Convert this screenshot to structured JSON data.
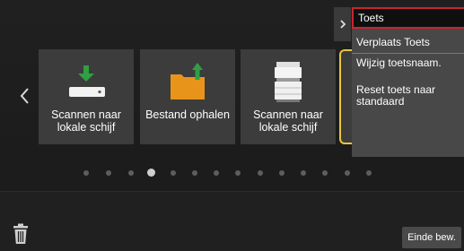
{
  "tiles": [
    {
      "label": "Scannen naar lokale schijf",
      "icon": "download-to-drive-icon"
    },
    {
      "label": "Bestand ophalen",
      "icon": "folder-upload-icon"
    },
    {
      "label": "Scannen naar lokale schijf",
      "icon": "printer-scanner-icon"
    }
  ],
  "menu": {
    "title": "Toets",
    "items": [
      "Verplaats Toets",
      "Wijzig toetsnaam.",
      "Reset toets naar standaard"
    ]
  },
  "pagination": {
    "total": 14,
    "active_index": 3
  },
  "footer": {
    "done_label": "Einde bew."
  },
  "colors": {
    "accent_green": "#2ea043",
    "folder_orange": "#e8941a",
    "highlight_yellow": "#e8c63a",
    "menu_border_red": "#c9252c"
  }
}
